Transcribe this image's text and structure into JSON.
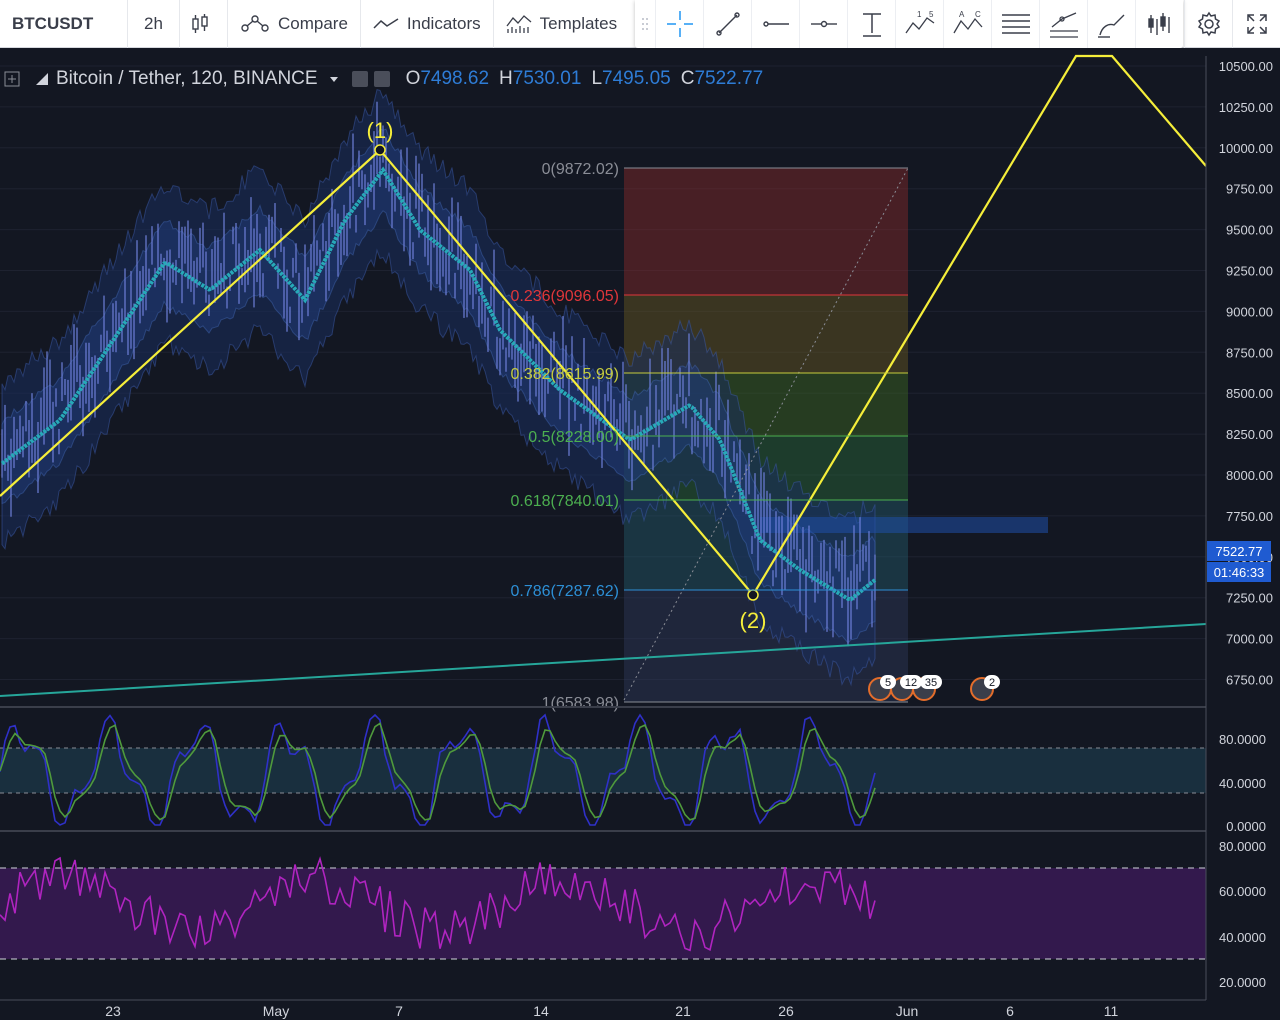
{
  "toolbar": {
    "symbol": "BTCUSDT",
    "interval": "2h",
    "compare": "Compare",
    "indicators": "Indicators",
    "templates": "Templates"
  },
  "legend": {
    "title": "Bitcoin / Tether, 120, BINANCE",
    "o_label": "O",
    "o_value": "7498.62",
    "h_label": "H",
    "h_value": "7530.01",
    "l_label": "L",
    "l_value": "7495.05",
    "c_label": "C",
    "c_value": "7522.77"
  },
  "price_axis": {
    "ticks": [
      "10500.00",
      "10250.00",
      "10000.00",
      "9750.00",
      "9500.00",
      "9250.00",
      "9000.00",
      "8750.00",
      "8500.00",
      "8250.00",
      "8000.00",
      "7750.00",
      "7500.00",
      "7250.00",
      "7000.00",
      "6750.00"
    ],
    "last_price": "7522.77",
    "countdown": "01:46:33"
  },
  "stoch_axis": {
    "ticks": [
      "80.0000",
      "40.0000",
      "0.0000"
    ]
  },
  "rsi_axis": {
    "ticks": [
      "80.0000",
      "60.0000",
      "40.0000",
      "20.0000"
    ]
  },
  "time_axis": {
    "ticks": [
      "23",
      "May",
      "7",
      "14",
      "21",
      "26",
      "Jun",
      "6",
      "11"
    ]
  },
  "fib": {
    "levels": [
      {
        "label": "0(9872.02)",
        "color": "#8a8d96"
      },
      {
        "label": "0.236(9096.05)",
        "color": "#e0363a"
      },
      {
        "label": "0.382(8615.99)",
        "color": "#c6cd3d"
      },
      {
        "label": "0.5(8228.00)",
        "color": "#4caf50"
      },
      {
        "label": "0.618(7840.01)",
        "color": "#4caf50"
      },
      {
        "label": "0.786(7287.62)",
        "color": "#2d8fd5"
      },
      {
        "label": "1(6583.98)",
        "color": "#8a8d96"
      }
    ]
  },
  "waves": {
    "w1": "(1)",
    "w2": "(2)"
  },
  "events": [
    "5",
    "12",
    "35",
    "2"
  ],
  "colors": {
    "background": "#131722",
    "yellow": "#f5ee3a",
    "ma": "#27a9b8",
    "stoch_k": "#2f30c8",
    "stoch_d": "#4f9a3c",
    "rsi": "#b024c0",
    "trend": "#26a69a",
    "price_tag": "#1f5bd1"
  },
  "chart_data": {
    "type": "line",
    "title": "Bitcoin / Tether, 120, BINANCE",
    "ylim": [
      6583.98,
      10600
    ],
    "x": [
      "Apr 20",
      "May 6",
      "May 24",
      "May 30"
    ],
    "series": [
      {
        "name": "",
        "values": [
          7840,
          9850,
          7250,
          7522.77
        ]
      }
    ]
  }
}
